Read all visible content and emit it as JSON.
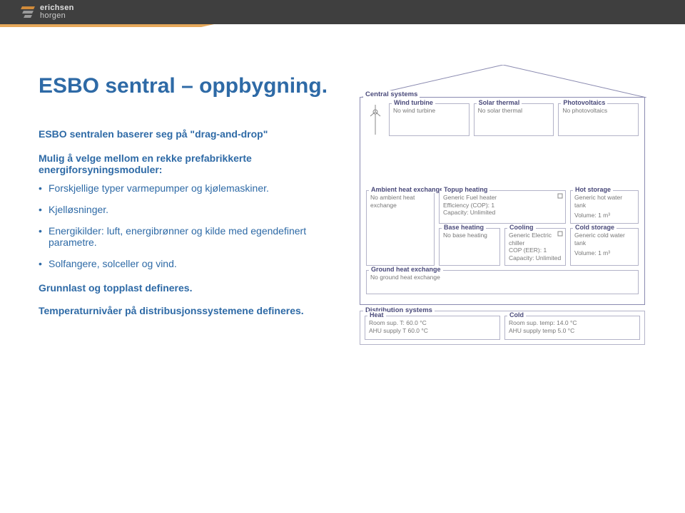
{
  "brand": {
    "line1": "erichsen",
    "line2": "horgen"
  },
  "title": "ESBO sentral – oppbygning.",
  "intro": "ESBO sentralen baserer seg på \"drag-and-drop\"",
  "subintro": "Mulig å velge mellom en rekke prefabrikkerte energiforsyningsmoduler:",
  "bullets": [
    "Forskjellige typer varmepumper og kjølemaskiner.",
    "Kjelløsninger.",
    "Energikilder: luft, energibrønner og kilde med egendefinert parametre.",
    "Solfangere, solceller og vind."
  ],
  "final1": "Grunnlast og topplast defineres.",
  "final2": "Temperaturnivåer på distribusjonssystemene defineres.",
  "diagram": {
    "central_label": "Central systems",
    "roof": {
      "wind": {
        "label": "Wind turbine",
        "text": "No wind turbine"
      },
      "solar": {
        "label": "Solar thermal",
        "text": "No solar thermal"
      },
      "pv": {
        "label": "Photovoltaics",
        "text": "No photovoltaics"
      }
    },
    "left": {
      "ambient": {
        "label": "Ambient heat exchange",
        "text": "No ambient heat exchange"
      }
    },
    "mid": {
      "topup": {
        "label": "Topup heating",
        "l1": "Generic Fuel heater",
        "l2": "Efficiency (COP): 1",
        "l3": "Capacity: Unlimited"
      },
      "base": {
        "label": "Base heating",
        "text": "No base heating"
      },
      "cool": {
        "label": "Cooling",
        "l1": "Generic Electric chiller",
        "l2": "COP (EER): 1",
        "l3": "Capacity: Unlimited"
      }
    },
    "right": {
      "hot": {
        "label": "Hot storage",
        "l1": "Generic hot water tank",
        "l2": "Volume: 1 m³"
      },
      "cold": {
        "label": "Cold storage",
        "l1": "Generic cold water tank",
        "l2": "Volume: 1 m³"
      }
    },
    "ground": {
      "label": "Ground heat exchange",
      "text": "No ground heat exchange"
    },
    "dist": {
      "label": "Distribution systems",
      "heat": {
        "label": "Heat",
        "l1": "Room sup. T: 60.0 °C",
        "l2": "AHU supply T 60.0 °C"
      },
      "cold": {
        "label": "Cold",
        "l1": "Room sup. temp: 14.0 °C",
        "l2": "AHU supply temp 5.0 °C"
      }
    }
  }
}
